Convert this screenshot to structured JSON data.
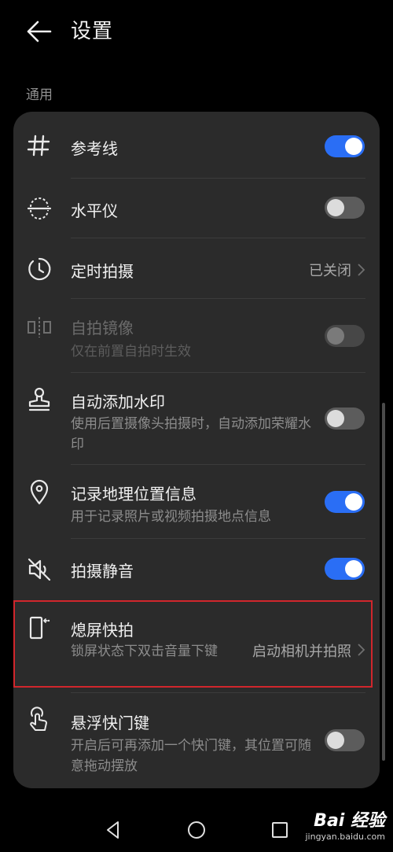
{
  "header": {
    "title": "设置"
  },
  "section": {
    "label": "通用"
  },
  "rows": [
    {
      "icon": "grid-icon",
      "label": "参考线",
      "control": "toggle",
      "state": true
    },
    {
      "icon": "level-icon",
      "label": "水平仪",
      "control": "toggle",
      "state": false
    },
    {
      "icon": "timer-icon",
      "label": "定时拍摄",
      "control": "value",
      "value": "已关闭"
    },
    {
      "icon": "mirror-icon",
      "label": "自拍镜像",
      "subtitle": "仅在前置自拍时生效",
      "control": "toggle",
      "state": false,
      "disabled": true
    },
    {
      "icon": "stamp-icon",
      "label": "自动添加水印",
      "subtitle": "使用后置摄像头拍摄时，自动添加荣耀水印",
      "control": "toggle",
      "state": false
    },
    {
      "icon": "location-icon",
      "label": "记录地理位置信息",
      "subtitle": "用于记录照片或视频拍摄地点信息",
      "control": "toggle",
      "state": true
    },
    {
      "icon": "mute-icon",
      "label": "拍摄静音",
      "control": "toggle",
      "state": true
    },
    {
      "icon": "phone-snap-icon",
      "label": "熄屏快拍",
      "subtitle": "锁屏状态下双击音量下键",
      "control": "value",
      "value": "启动相机并拍照"
    },
    {
      "icon": "touch-icon",
      "label": "悬浮快门键",
      "subtitle": "开启后可再添加一个快门键，其位置可随意拖动摆放",
      "control": "toggle",
      "state": false
    }
  ],
  "watermark": {
    "brand": "Bai 经验",
    "url": "jingyan.baidu.com"
  }
}
